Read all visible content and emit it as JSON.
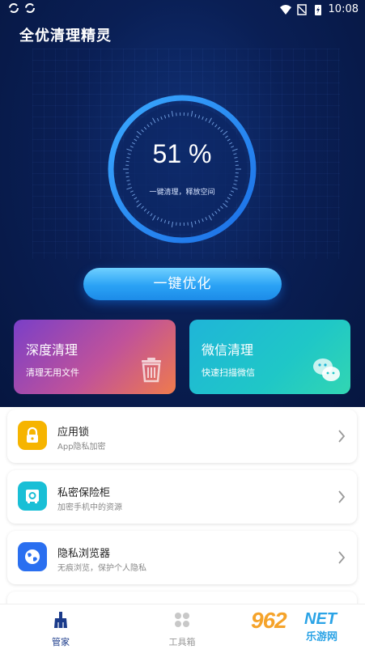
{
  "status_bar": {
    "time": "10:08",
    "left_icons": [
      "sync-icon",
      "sync-icon"
    ],
    "right_icons": [
      "wifi-icon",
      "no-sim-icon",
      "battery-charging-icon"
    ]
  },
  "app": {
    "title": "全优清理精灵"
  },
  "gauge": {
    "percent_text": "51 %",
    "percent_value": 51,
    "subtitle": "一键清理，释放空间"
  },
  "optimize_button": {
    "label": "一键优化"
  },
  "cards": [
    {
      "title": "深度清理",
      "subtitle": "清理无用文件",
      "icon": "trash-icon"
    },
    {
      "title": "微信清理",
      "subtitle": "快速扫描微信",
      "icon": "wechat-icon"
    }
  ],
  "list": [
    {
      "title": "应用锁",
      "subtitle": "App隐私加密",
      "icon": "lock-icon",
      "color": "#f6b400"
    },
    {
      "title": "私密保险柜",
      "subtitle": "加密手机中的资源",
      "icon": "safe-icon",
      "color": "#19bfd6"
    },
    {
      "title": "隐私浏览器",
      "subtitle": "无痕浏览，保护个人隐私",
      "icon": "globe-icon",
      "color": "#2a6ff0"
    }
  ],
  "tabs": [
    {
      "label": "管家",
      "icon": "broom-icon",
      "active": true
    },
    {
      "label": "工具箱",
      "icon": "grid-icon",
      "active": false
    }
  ],
  "watermark": {
    "number": "962",
    "suffix": "NET",
    "chinese": "乐游网"
  },
  "colors": {
    "header_bg": "#0a1f55",
    "accent_blue": "#2aa2f5",
    "tab_active": "#1a3a8a",
    "tab_inactive": "#999999"
  }
}
